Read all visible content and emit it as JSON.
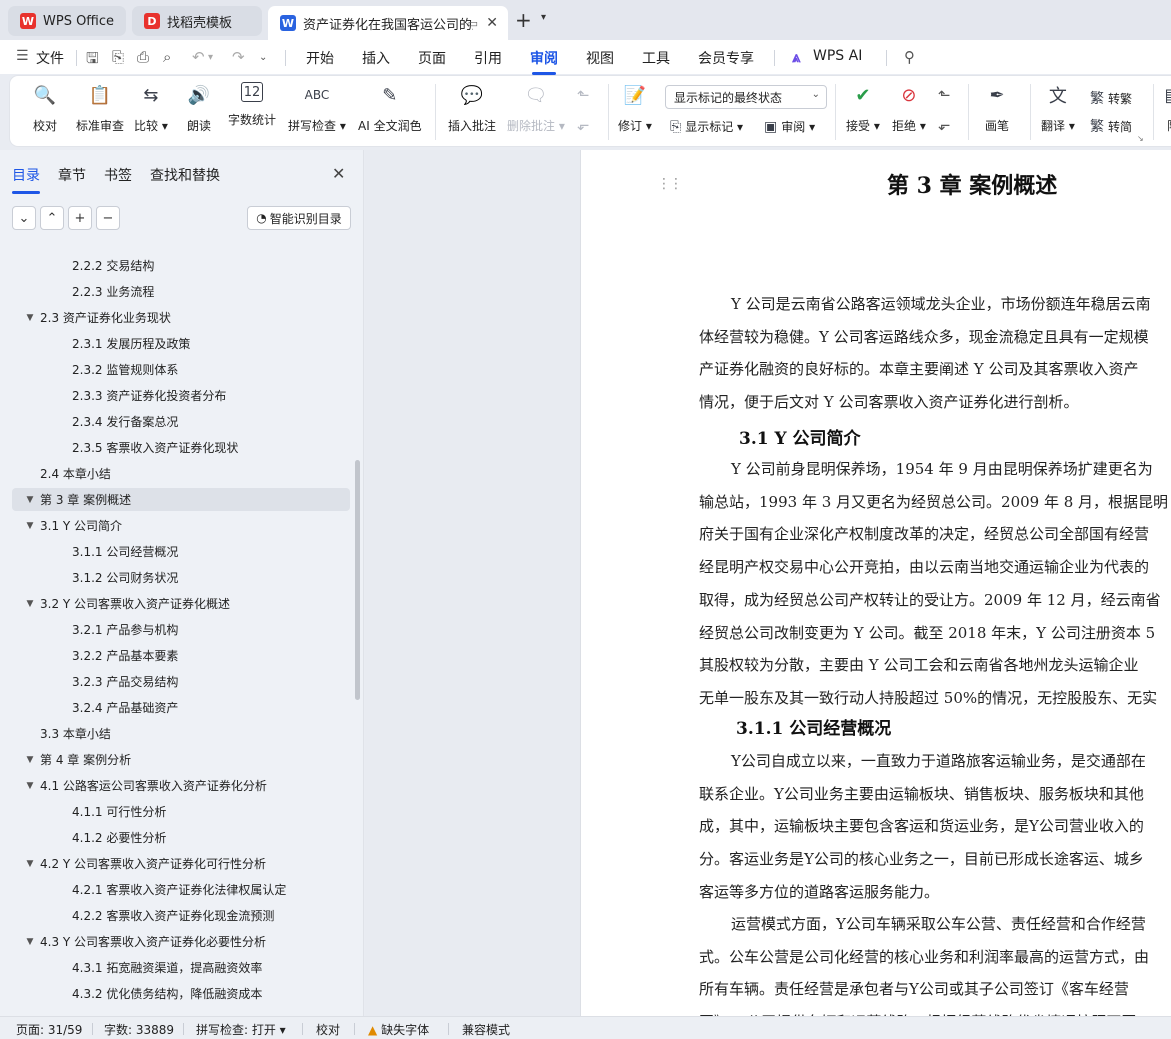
{
  "tabs": {
    "wps": "WPS Office",
    "daoke": "找稻壳模板",
    "doc": "资产证券化在我国客运公司的应用",
    "new_tab": "+",
    "tab_list": "⌄"
  },
  "menu": {
    "file": "文件",
    "items": [
      "开始",
      "插入",
      "页面",
      "引用",
      "审阅",
      "视图",
      "工具",
      "会员专享"
    ],
    "active": "审阅",
    "ai": "WPS AI"
  },
  "ribbon": {
    "proofread": "校对",
    "standard_review": "标准审查",
    "compare": "比较",
    "read_aloud": "朗读",
    "word_count": "字数统计",
    "spell_check": "拼写检查",
    "ai_polish": "AI 全文润色",
    "insert_comment": "插入批注",
    "delete_comment": "删除批注",
    "display_mode": "显示标记的最终状态",
    "track_changes": "修订",
    "show_markup": "显示标记",
    "review": "审阅",
    "accept": "接受",
    "reject": "拒绝",
    "pen": "画笔",
    "translate": "翻译",
    "to_traditional": "转繁",
    "to_simplified": "转简",
    "cut_text": "限"
  },
  "nav": {
    "tabs": [
      "目录",
      "章节",
      "书签",
      "查找和替换"
    ],
    "active_tab": "目录",
    "smart_toc": "智能识别目录",
    "toc": [
      {
        "label": "2.2.2 交易结构",
        "level": 3
      },
      {
        "label": "2.2.3 业务流程",
        "level": 3
      },
      {
        "label": "2.3 资产证券化业务现状",
        "level": 2,
        "expanded": true
      },
      {
        "label": "2.3.1 发展历程及政策",
        "level": 3
      },
      {
        "label": "2.3.2 监管规则体系",
        "level": 3
      },
      {
        "label": "2.3.3 资产证券化投资者分布",
        "level": 3
      },
      {
        "label": "2.3.4 发行备案总况",
        "level": 3
      },
      {
        "label": "2.3.5 客票收入资产证券化现状",
        "level": 3
      },
      {
        "label": "2.4 本章小结",
        "level": 2
      },
      {
        "label": "第 3 章  案例概述",
        "level": 1,
        "expanded": true,
        "selected": true
      },
      {
        "label": "3.1 Y 公司简介",
        "level": 2,
        "expanded": true
      },
      {
        "label": "3.1.1 公司经营概况",
        "level": 3
      },
      {
        "label": "3.1.2 公司财务状况",
        "level": 3
      },
      {
        "label": "3.2 Y 公司客票收入资产证券化概述",
        "level": 2,
        "expanded": true
      },
      {
        "label": "3.2.1 产品参与机构",
        "level": 3
      },
      {
        "label": "3.2.2 产品基本要素",
        "level": 3
      },
      {
        "label": "3.2.3 产品交易结构",
        "level": 3
      },
      {
        "label": "3.2.4 产品基础资产",
        "level": 3
      },
      {
        "label": "3.3 本章小结",
        "level": 2
      },
      {
        "label": "第 4 章  案例分析",
        "level": 1,
        "expanded": true
      },
      {
        "label": "4.1 公路客运公司客票收入资产证券化分析",
        "level": 2,
        "expanded": true
      },
      {
        "label": "4.1.1 可行性分析",
        "level": 3
      },
      {
        "label": "4.1.2 必要性分析",
        "level": 3
      },
      {
        "label": "4.2 Y 公司客票收入资产证券化可行性分析",
        "level": 2,
        "expanded": true
      },
      {
        "label": "4.2.1 客票收入资产证券化法律权属认定",
        "level": 3
      },
      {
        "label": "4.2.2 客票收入资产证券化现金流预测",
        "level": 3
      },
      {
        "label": "4.3 Y 公司客票收入资产证券化必要性分析",
        "level": 2,
        "expanded": true
      },
      {
        "label": "4.3.1 拓宽融资渠道，提高融资效率",
        "level": 3
      },
      {
        "label": "4.3.2 优化债务结构，降低融资成本",
        "level": 3
      }
    ]
  },
  "document": {
    "chapter_title": "第 3 章  案例概述",
    "intro": [
      "Y 公司是云南省公路客运领域龙头企业，市场份额连年稳居云南",
      "体经营较为稳健。Y 公司客运路线众多，现金流稳定且具有一定规模",
      "产证券化融资的良好标的。本章主要阐述 Y 公司及其客票收入资产",
      "情况，便于后文对 Y 公司客票收入资产证券化进行剖析。"
    ],
    "h_3_1": "3.1 Y 公司简介",
    "p_3_1": [
      "Y 公司前身昆明保养场，1954 年 9 月由昆明保养场扩建更名为",
      "输总站，1993 年 3 月又更名为经贸总公司。2009 年 8 月，根据昆明",
      "府关于国有企业深化产权制度改革的决定，经贸总公司全部国有经营",
      "经昆明产权交易中心公开竞拍，由以云南当地交通运输企业为代表的",
      "取得，成为经贸总公司产权转让的受让方。2009 年 12 月，经云南省",
      "经贸总公司改制变更为 Y 公司。截至 2018 年末，Y 公司注册资本 5",
      "其股权较为分散，主要由 Y 公司工会和云南省各地州龙头运输企业",
      "无单一股东及其一致行动人持股超过 50%的情况，无控股股东、无实"
    ],
    "h_3_1_1": "3.1.1 公司经营概况",
    "p_3_1_1": [
      "Y公司自成立以来，一直致力于道路旅客运输业务，是交通部在",
      "联系企业。Y公司业务主要由运输板块、销售板块、服务板块和其他",
      "成，其中，运输板块主要包含客运和货运业务，是Y公司营业收入的",
      "分。客运业务是Y公司的核心业务之一，目前已形成长途客运、城乡",
      "客运等多方位的道路客运服务能力。"
    ],
    "p_ops": [
      "运营模式方面，Y公司车辆采取公车公营、责任经营和合作经营",
      "式。公车公营是公司化经营的核心业务和利润率最高的运营方式，由",
      "所有车辆。责任经营是承包者与Y公司或其子公司签订《客车经营",
      "同》，Y公司提供车辆和运营线路，根据经营线路优劣情况按照不同"
    ]
  },
  "status": {
    "page": "页面: 31/59",
    "words": "字数: 33889",
    "spell": "拼写检查: 打开",
    "proof": "校对",
    "missing_font": "缺失字体",
    "compat": "兼容模式"
  },
  "colors": {
    "accent": "#1e56e6",
    "wps_red": "#e8322d",
    "word_blue": "#2a63e0"
  }
}
